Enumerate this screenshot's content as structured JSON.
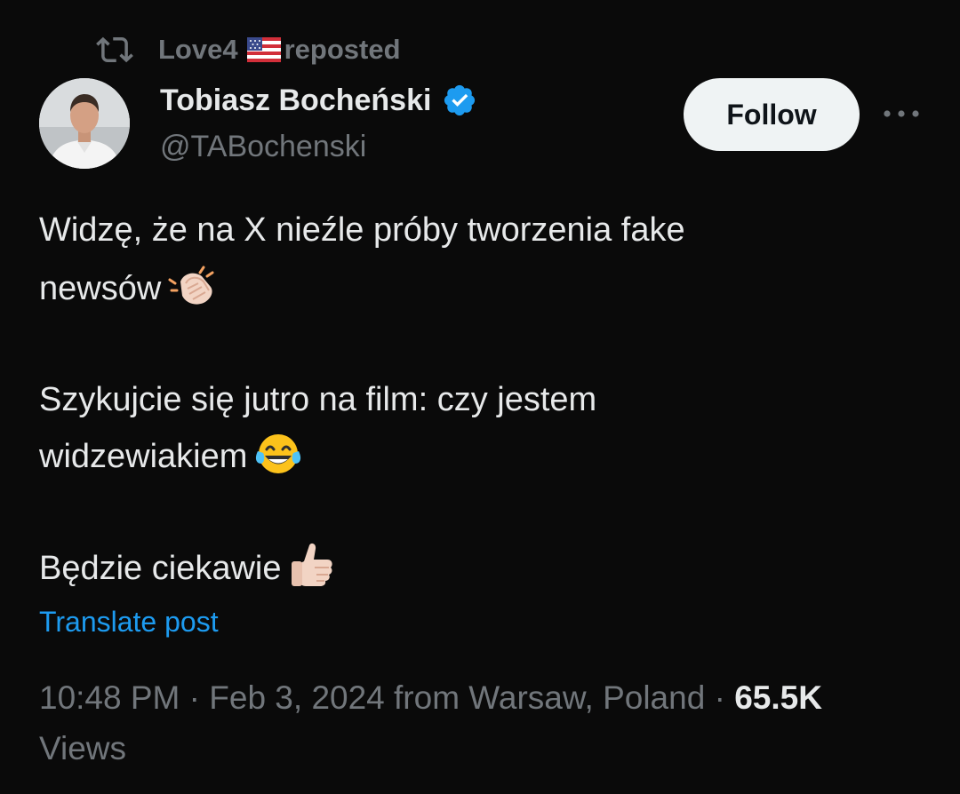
{
  "repost": {
    "user": "Love4",
    "flag": "us-flag-icon",
    "label": "reposted"
  },
  "author": {
    "name": "Tobiasz Bocheński",
    "handle": "@TABochenski",
    "verified": true,
    "verified_color": "#1d9bf0"
  },
  "actions": {
    "follow_label": "Follow",
    "more": "more-options-icon"
  },
  "post": {
    "line1": "Widzę, że na X nieźle próby tworzenia fake",
    "line2": "newsów",
    "line3": "Szykujcie się jutro na film: czy jestem",
    "line4": "widzewiakiem",
    "line5": "Będzie ciekawie",
    "emojis": [
      "clapping-hands-icon",
      "tears-of-joy-icon",
      "thumbs-up-icon"
    ]
  },
  "translate_label": "Translate post",
  "meta": {
    "time": "10:48 PM",
    "separator": " · ",
    "date": "Feb 3, 2024",
    "location": "from Warsaw, Poland",
    "views_count": "65.5K",
    "views_label": "Views"
  },
  "colors": {
    "background": "#0a0a0a",
    "text": "#e7e9ea",
    "muted": "#71767b",
    "link": "#1d9bf0",
    "follow_bg": "#eff3f4"
  }
}
